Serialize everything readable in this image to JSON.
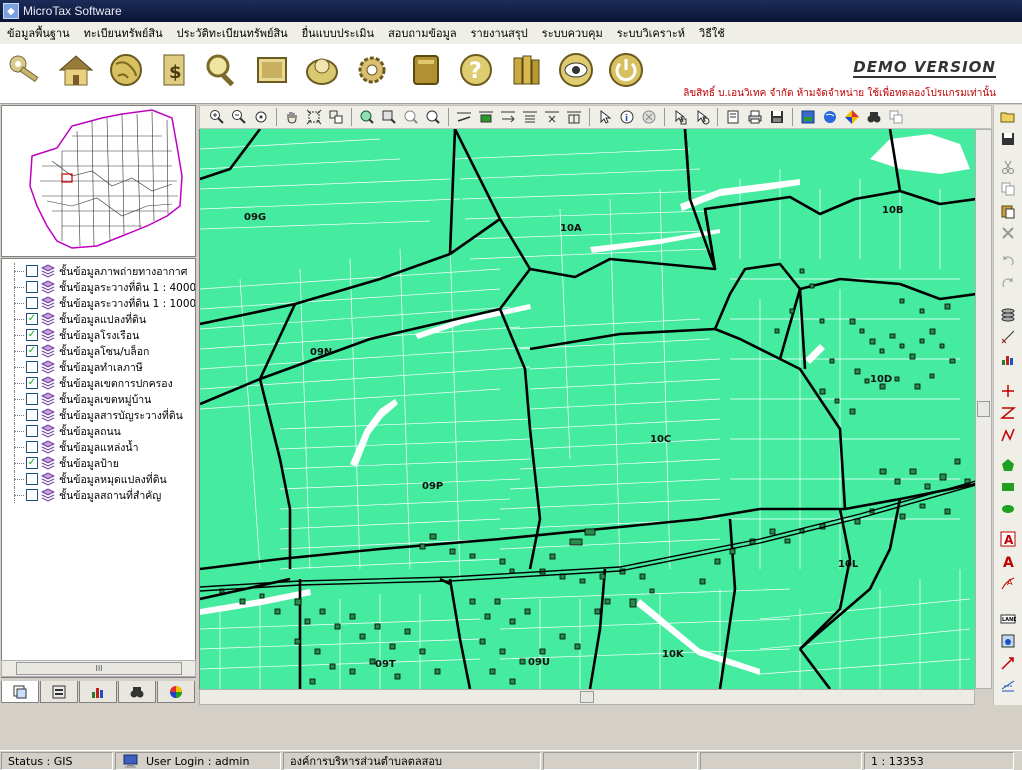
{
  "window": {
    "title": "MicroTax Software"
  },
  "menu": [
    "ข้อมูลพื้นฐาน",
    "ทะเบียนทรัพย์สิน",
    "ประวัติทะเบียนทรัพย์สิน",
    "ยื่นแบบประเมิน",
    "สอบถามข้อมูล",
    "รายงานสรุป",
    "ระบบควบคุม",
    "ระบบวิเคราะห์",
    "วิธีใช้"
  ],
  "toolbar_icons": [
    "key-icon",
    "home-icon",
    "globe-icon",
    "money-document-icon",
    "search-magnifier-icon",
    "photo-frame-icon",
    "map-globe-icon",
    "settings-gear-icon",
    "book-icon",
    "help-icon",
    "books-icon",
    "eye-icon",
    "power-icon"
  ],
  "branding": {
    "demo": "DEMO VERSION",
    "copyright": "ลิขสิทธิ์ บ.เอนวิเทค จำกัด ห้ามจัดจำหน่าย ใช้เพื่อทดลองโปรแกรมเท่านั้น"
  },
  "layers": [
    {
      "label": "ชั้นข้อมูลภาพถ่ายทางอากาศ",
      "checked": false
    },
    {
      "label": "ชั้นข้อมูลระวางที่ดิน 1 : 4000",
      "checked": false
    },
    {
      "label": "ชั้นข้อมูลระวางที่ดิน 1 : 1000",
      "checked": false
    },
    {
      "label": "ชั้นข้อมูลแปลงที่ดิน",
      "checked": true
    },
    {
      "label": "ชั้นข้อมูลโรงเรือน",
      "checked": true
    },
    {
      "label": "ชั้นข้อมูลโซน/บล็อก",
      "checked": true
    },
    {
      "label": "ชั้นข้อมูลทำเลภาษี",
      "checked": false
    },
    {
      "label": "ชั้นข้อมูลเขตการปกครอง",
      "checked": true
    },
    {
      "label": "ชั้นข้อมูลเขตหมู่บ้าน",
      "checked": false
    },
    {
      "label": "ชั้นข้อมูลสารบัญระวางที่ดิน",
      "checked": false
    },
    {
      "label": "ชั้นข้อมูลถนน",
      "checked": false
    },
    {
      "label": "ชั้นข้อมูลแหล่งน้ำ",
      "checked": false
    },
    {
      "label": "ชั้นข้อมูลป้าย",
      "checked": true
    },
    {
      "label": "ชั้นข้อมูลหมุดแปลงที่ดิน",
      "checked": false
    },
    {
      "label": "ชั้นข้อมูลสถานที่สำคัญ",
      "checked": false
    }
  ],
  "left_scroll_label": "III",
  "map_zones": [
    "09G",
    "10A",
    "10B",
    "09N",
    "10D",
    "10C",
    "09P",
    "10L",
    "09T",
    "09U",
    "10K"
  ],
  "status": {
    "mode": "Status : GIS",
    "user": "User Login : admin",
    "org": "องค์การบริหารส่วนตำบลตลสอบ",
    "scale": "1 : 13353"
  },
  "colors": {
    "map_fill": "#45eca0",
    "boundary": "#000000",
    "titlebar": "#0a1433"
  }
}
